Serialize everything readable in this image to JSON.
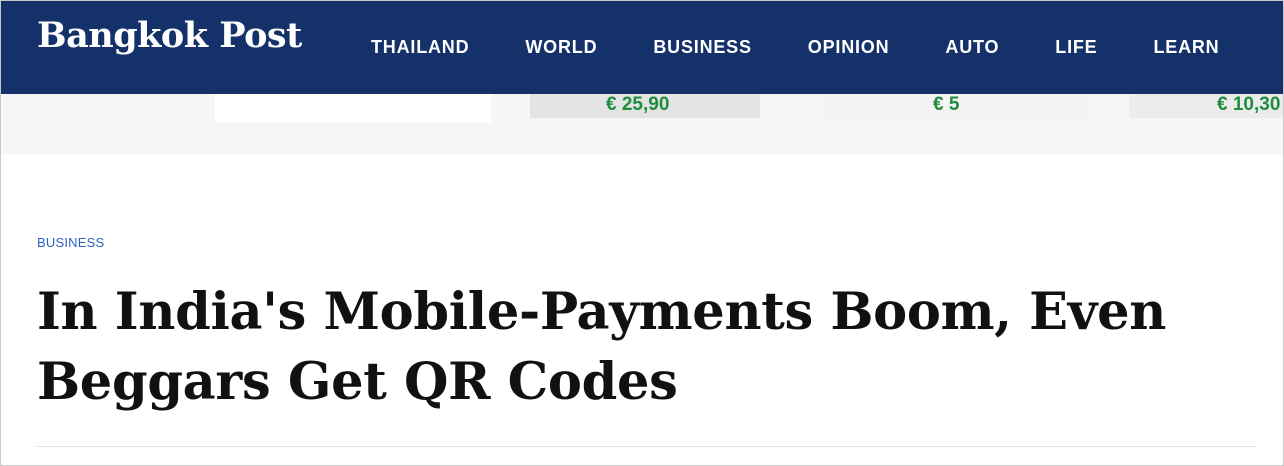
{
  "site": {
    "logo_text": "Bangkok Post"
  },
  "nav": {
    "items": [
      "THAILAND",
      "WORLD",
      "BUSINESS",
      "OPINION",
      "AUTO",
      "LIFE",
      "LEARN"
    ]
  },
  "ads": {
    "prices": [
      "€ 25,90",
      "€ 5",
      "€ 10,30"
    ],
    "price_color": "#1e8e3e"
  },
  "article": {
    "category": "BUSINESS",
    "headline": "In India's Mobile-Payments Boom, Even Beggars Get QR Codes"
  },
  "colors": {
    "header_bg": "#14316a",
    "category_link": "#2b62c2"
  }
}
